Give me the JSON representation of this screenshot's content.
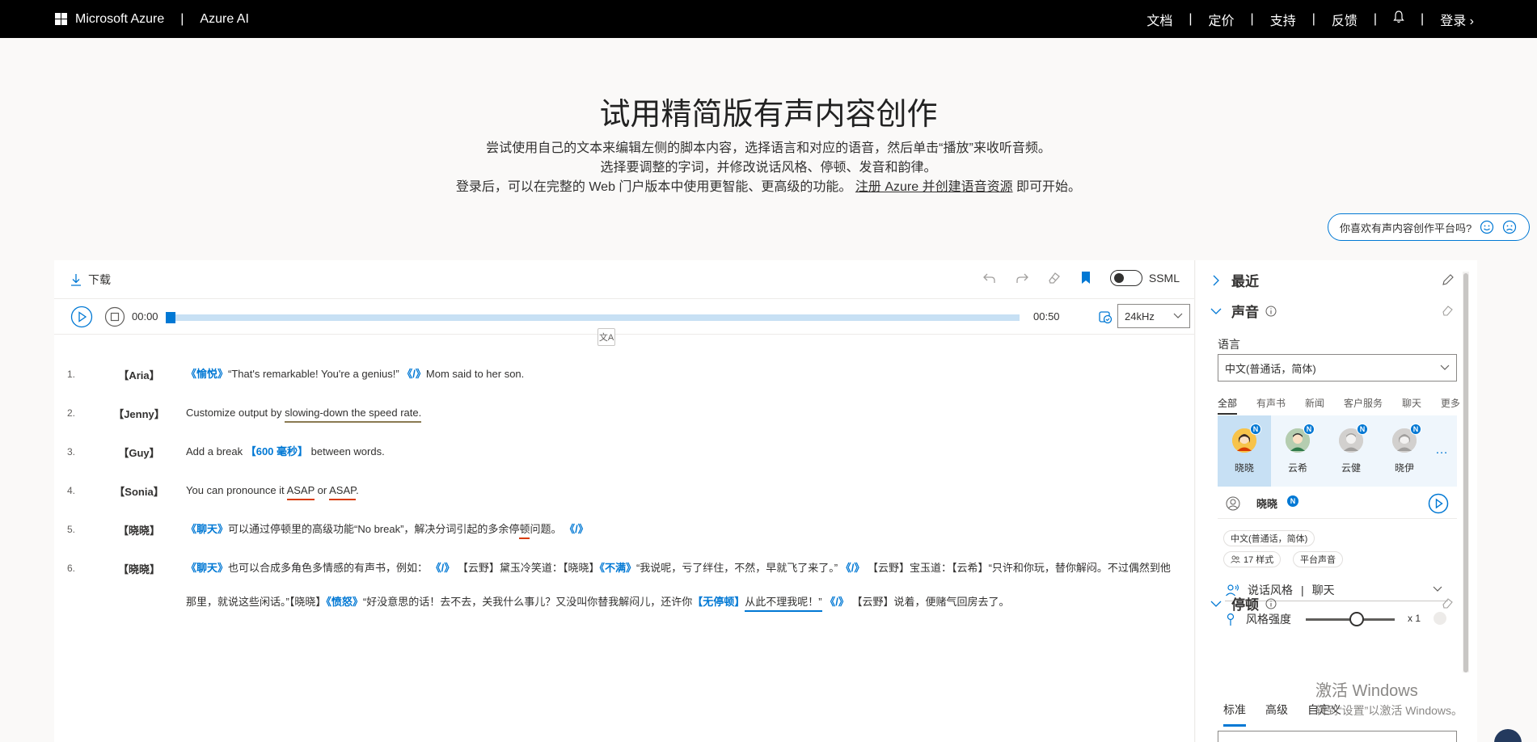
{
  "header": {
    "brand": "Microsoft Azure",
    "separator": "|",
    "product": "Azure AI",
    "nav": [
      "文档",
      "定价",
      "支持",
      "反馈"
    ],
    "login": "登录"
  },
  "hero": {
    "title": "试用精简版有声内容创作",
    "line1": "尝试使用自己的文本来编辑左侧的脚本内容，选择语言和对应的语音，然后单击“播放”来收听音频。",
    "line2": "选择要调整的字词，并修改说话风格、停顿、发音和韵律。",
    "line3_pre": "登录后，可以在完整的 Web 门户版本中使用更智能、更高级的功能。",
    "line3_link": "注册 Azure 并创建语音资源",
    "line3_post": "即可开始。"
  },
  "feedback": {
    "question": "你喜欢有声内容创作平台吗?"
  },
  "toolbar": {
    "download": "下载",
    "ssml": "SSML"
  },
  "player": {
    "time_start": "00:00",
    "time_end": "00:50",
    "progress": 0,
    "sample_rate": "24kHz"
  },
  "script_lines": [
    {
      "num": "1.",
      "speaker": "【Aria】"
    },
    {
      "num": "2.",
      "speaker": "【Jenny】"
    },
    {
      "num": "3.",
      "speaker": "【Guy】"
    },
    {
      "num": "4.",
      "speaker": "【Sonia】"
    },
    {
      "num": "5.",
      "speaker": "【晓晓】"
    },
    {
      "num": "6.",
      "speaker": "【晓晓】"
    }
  ],
  "script": {
    "l1": {
      "tag": "《愉悦》",
      "text": "“That's remarkable! You're a genius!” ",
      "end": "《/》",
      "tail": "Mom said to her son."
    },
    "l2": {
      "pre": "Customize output by ",
      "mark": "slowing-down the speed rate."
    },
    "l3": {
      "pre": "Add a break ",
      "tag": "【600 毫秒】",
      "post": " between words."
    },
    "l4": {
      "pre": "You can pronounce it ",
      "a1": "ASAP",
      "mid": " or ",
      "a2": "ASAP",
      "post": "."
    },
    "l5": {
      "tag": "《聊天》",
      "pre": "可以通过停顿里的高级功能“No break”，解决分词引起的多余停",
      "mark": "顿",
      "post": "问题。",
      "end": "《/》"
    },
    "l6": {
      "tag": "《聊天》",
      "t1": "也可以合成多角色多情感的有声书，例如：",
      "e1": "《/》",
      "s1": "【云野】",
      "t2": "黛玉冷笑道：",
      "s2": "【晓晓】",
      "tag2": "《不满》",
      "t3": "“我说呢，亏了绊住，不然，早就飞了来了。”",
      "e2": "《/》",
      "s3": "【云野】",
      "t4": "宝玉道：",
      "s4": "【云希】",
      "t5": "“只许和你玩，替你解闷。不过偶然到他那里，就说这些闲话。”",
      "s5": "【晓晓】",
      "tag3": "《愤怒》",
      "t6": "“好没意思的话！去不去，关我什么事儿？又没叫你替我解闷儿，还许你",
      "tag4": "【无停顿】",
      "t7": "从此不理我呢！”",
      "e3": "《/》",
      "s6": "【云野】",
      "t8": "说着，便赌气回房去了。"
    }
  },
  "sidebar": {
    "recent": "最近",
    "voice_section": "声音",
    "language_label": "语言",
    "language_value": "中文(普通话，简体)",
    "categories": [
      "全部",
      "有声书",
      "新闻",
      "客户服务",
      "聊天",
      "更多"
    ],
    "voices": [
      {
        "name": "晓晓",
        "badge": "N"
      },
      {
        "name": "云希",
        "badge": "N"
      },
      {
        "name": "云健",
        "badge": "N"
      },
      {
        "name": "晓伊",
        "badge": "N"
      }
    ],
    "more": "…",
    "selected_voice": "晓晓",
    "selected_badge": "N",
    "chip_lang": "中文(普通话，简体)",
    "chip_styles": "17 样式",
    "chip_platform": "平台声音",
    "style_label": "说话风格",
    "style_sep": "|",
    "style_value": "聊天",
    "strength_label": "风格强度",
    "strength_value": "x 1",
    "pause_section": "停顿",
    "pause_tabs": [
      "标准",
      "高级",
      "自定义"
    ]
  },
  "watermark": {
    "line1": "激活 Windows",
    "line2": "转到“设置”以激活 Windows。"
  }
}
